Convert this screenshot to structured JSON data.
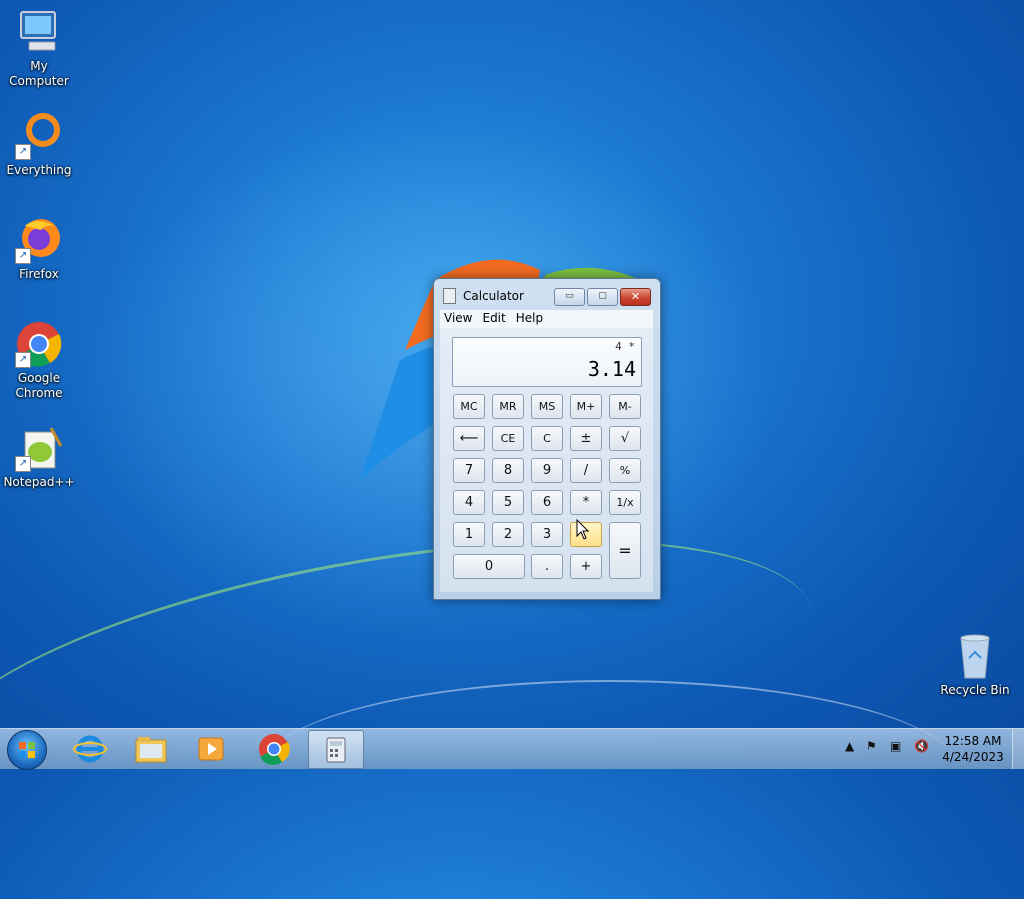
{
  "desktop": {
    "icons": [
      {
        "label": "My Computer",
        "icon": "computer-icon"
      },
      {
        "label": "Everything",
        "icon": "everything-icon"
      },
      {
        "label": "Firefox",
        "icon": "firefox-icon"
      },
      {
        "label": "Google Chrome",
        "icon": "chrome-icon"
      },
      {
        "label": "Notepad++",
        "icon": "notepadpp-icon"
      },
      {
        "label": "Recycle Bin",
        "icon": "recycle-bin-icon"
      }
    ]
  },
  "calculator": {
    "title": "Calculator",
    "window_buttons": {
      "minimize": "▭",
      "maximize": "▢",
      "close": "✕"
    },
    "menu": [
      "View",
      "Edit",
      "Help"
    ],
    "display": {
      "expression": "4 *",
      "value": "3.14"
    },
    "keys": {
      "mc": "MC",
      "mr": "MR",
      "ms": "MS",
      "mplus": "M+",
      "mminus": "M-",
      "back": "⟵",
      "ce": "CE",
      "c": "C",
      "plusminus": "±",
      "sqrt": "√",
      "k7": "7",
      "k8": "8",
      "k9": "9",
      "div": "/",
      "pct": "%",
      "k4": "4",
      "k5": "5",
      "k6": "6",
      "mul": "*",
      "recip": "1/x",
      "k1": "1",
      "k2": "2",
      "k3": "3",
      "minus": "",
      "k0": "0",
      "dot": ".",
      "plus": "+",
      "eq": "="
    }
  },
  "taskbar": {
    "apps": [
      "internet-explorer-icon",
      "file-explorer-icon",
      "media-player-icon",
      "chrome-icon",
      "calculator-icon"
    ],
    "clock": {
      "time": "12:58 AM",
      "date": "4/24/2023"
    }
  }
}
